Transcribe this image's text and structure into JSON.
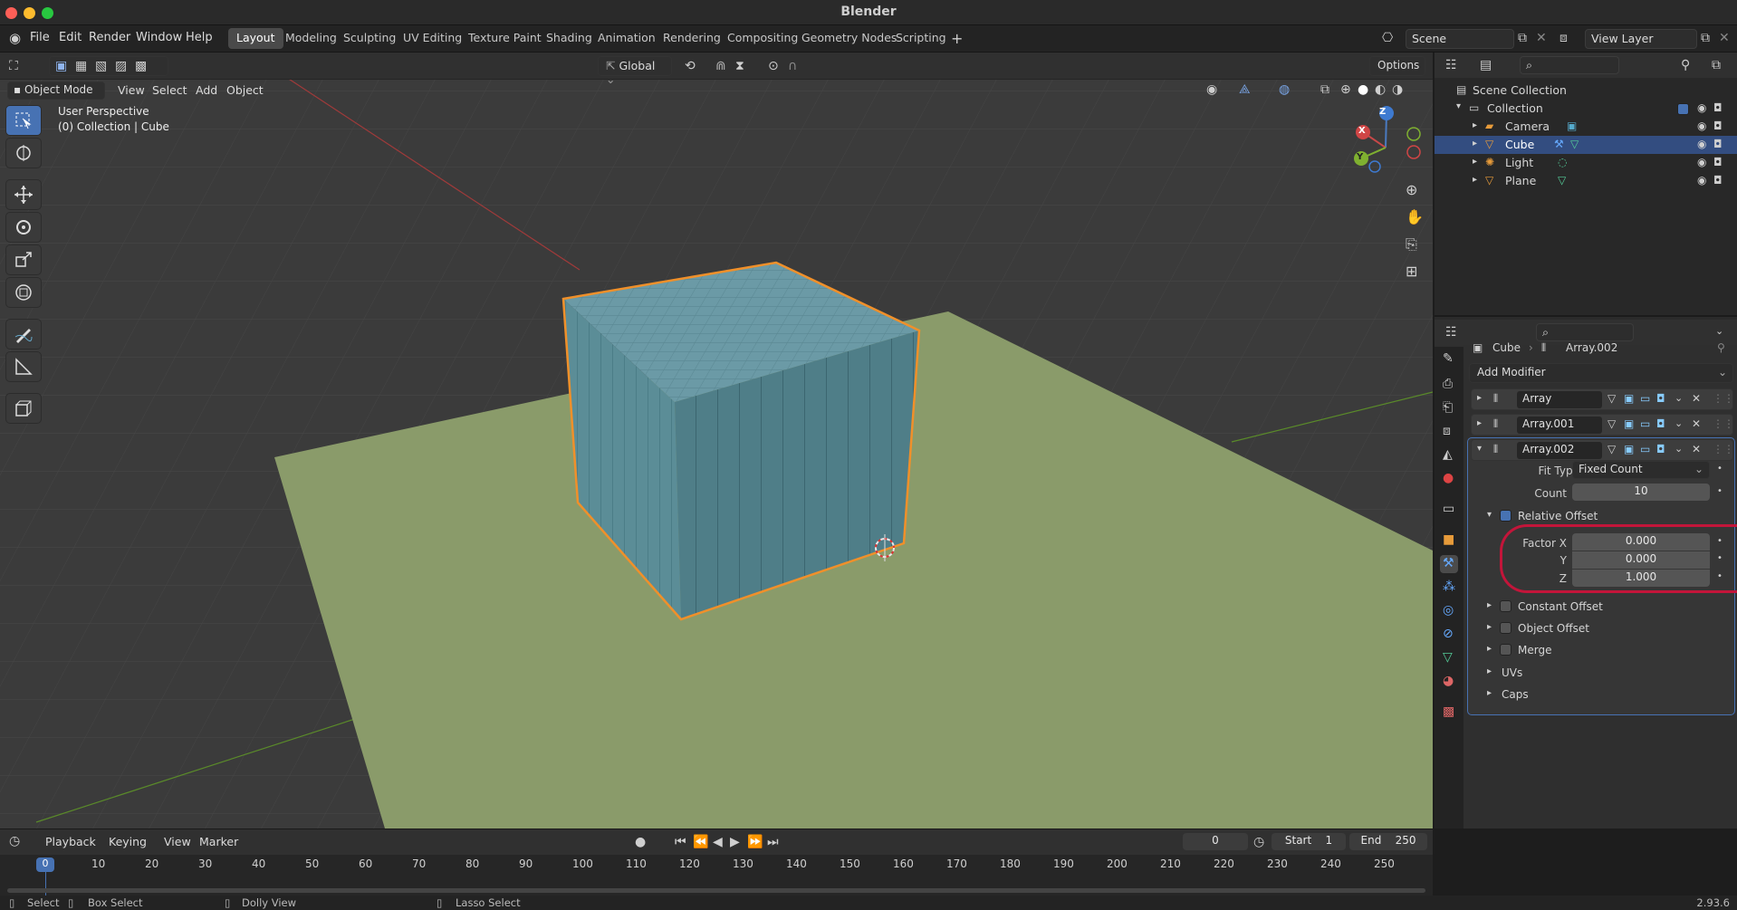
{
  "window": {
    "title": "Blender"
  },
  "menus": [
    "File",
    "Edit",
    "Render",
    "Window",
    "Help"
  ],
  "workspaces": [
    "Layout",
    "Modeling",
    "Sculpting",
    "UV Editing",
    "Texture Paint",
    "Shading",
    "Animation",
    "Rendering",
    "Compositing",
    "Geometry Nodes",
    "Scripting"
  ],
  "active_workspace": "Layout",
  "scene": {
    "name": "Scene",
    "view_layer": "View Layer"
  },
  "viewport": {
    "mode": "Object Mode",
    "menus": [
      "View",
      "Select",
      "Add",
      "Object"
    ],
    "transform_orientation": "Global",
    "options_label": "Options",
    "info_line1": "User Perspective",
    "info_line2": "(0) Collection | Cube",
    "gizmo_axes": [
      "Z",
      "X",
      "Y"
    ]
  },
  "outliner": {
    "root": "Scene Collection",
    "collection": "Collection",
    "items": [
      {
        "name": "Camera",
        "selected": false
      },
      {
        "name": "Cube",
        "selected": true
      },
      {
        "name": "Light",
        "selected": false
      },
      {
        "name": "Plane",
        "selected": false
      }
    ]
  },
  "properties": {
    "breadcrumb_object": "Cube",
    "breadcrumb_modifier": "Array.002",
    "add_modifier": "Add Modifier",
    "modifiers": [
      "Array",
      "Array.001",
      "Array.002"
    ],
    "fit_type_label": "Fit Type",
    "fit_type_value": "Fixed Count",
    "count_label": "Count",
    "count_value": "10",
    "relative_offset_label": "Relative Offset",
    "relative_offset_enabled": true,
    "factor_x_label": "Factor X",
    "factor_x": "0.000",
    "y_label": "Y",
    "factor_y": "0.000",
    "z_label": "Z",
    "factor_z": "1.000",
    "constant_offset": "Constant Offset",
    "object_offset": "Object Offset",
    "merge": "Merge",
    "uvs": "UVs",
    "caps": "Caps"
  },
  "timeline": {
    "menus": [
      "Playback",
      "Keying",
      "View",
      "Marker"
    ],
    "current_frame": "0",
    "start_label": "Start",
    "start": "1",
    "end_label": "End",
    "end": "250",
    "ticks": [
      "0",
      "10",
      "20",
      "30",
      "40",
      "50",
      "60",
      "70",
      "80",
      "90",
      "100",
      "110",
      "120",
      "130",
      "140",
      "150",
      "160",
      "170",
      "180",
      "190",
      "200",
      "210",
      "220",
      "230",
      "240",
      "250"
    ]
  },
  "statusbar": {
    "select": "Select",
    "box_select": "Box Select",
    "dolly_view": "Dolly View",
    "lasso_select": "Lasso Select",
    "version": "2.93.6"
  },
  "colors": {
    "accent": "#4772b3",
    "selection_outline": "#f0902a",
    "plane": "#8a9b6a",
    "cube": "#4f7e88",
    "highlight_ring": "#c3153a"
  }
}
